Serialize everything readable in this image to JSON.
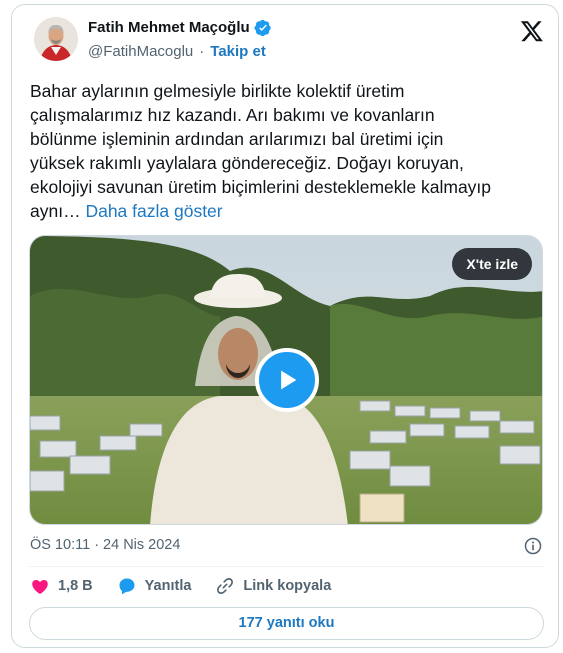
{
  "author": {
    "name": "Fatih Mehmet Maçoğlu",
    "handle": "@FatihMacoglu",
    "separator": "·",
    "follow_label": "Takip et",
    "avatar_icon": "avatar-portrait",
    "verified_icon": "verified-badge-icon",
    "verified_color": "#1d9bf0"
  },
  "brand": {
    "logo_icon": "x-logo-icon"
  },
  "tweet": {
    "lines": [
      "Bahar aylarının gelmesiyle birlikte kolektif üretim",
      "çalışmalarımız hız kazandı. Arı bakımı ve kovanların",
      "bölünme işleminin ardından arılarımızı bal üretimi için",
      "yüksek rakımlı yaylalara göndereceğiz. Doğayı koruyan,",
      "ekolojiyi savunan üretim biçimlerini desteklemekle kalmayıp",
      "aynı…"
    ],
    "show_more": "Daha fazla göster"
  },
  "media": {
    "watch_label": "X'te izle",
    "play_icon": "play-icon",
    "accent_color": "#1d9bf0"
  },
  "meta": {
    "time": "ÖS 10:11",
    "separator": "·",
    "date": "24 Nis 2024",
    "info_icon": "info-icon"
  },
  "actions": {
    "like_count": "1,8 B",
    "like_color": "#f91880",
    "reply_label": "Yanıtla",
    "copy_link_label": "Link kopyala"
  },
  "read_replies_label": "177 yanıtı oku"
}
